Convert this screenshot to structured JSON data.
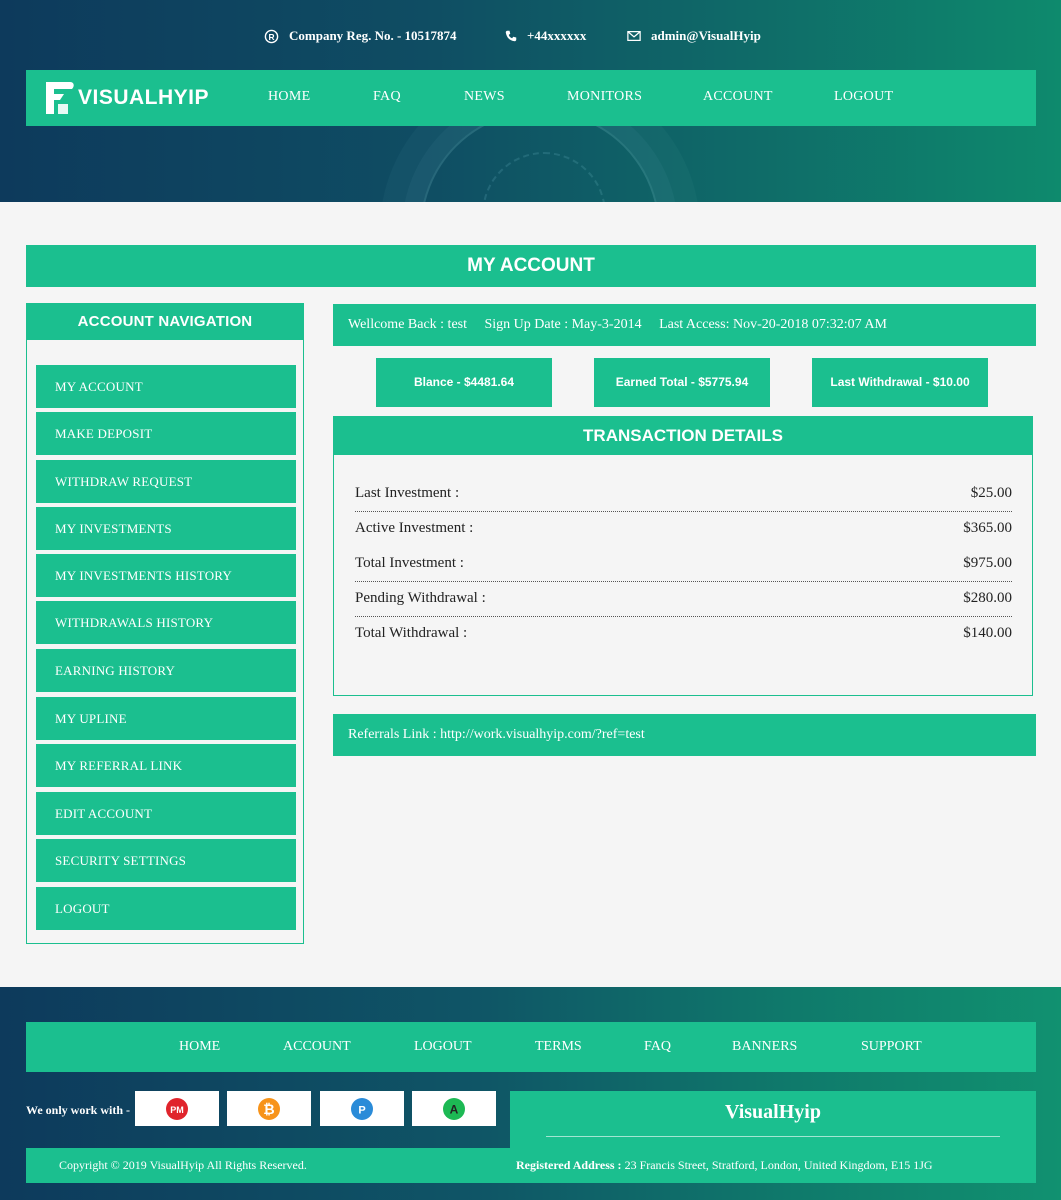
{
  "topbar": {
    "company_reg": "Company Reg. No. - 10517874",
    "phone": "+44xxxxxx",
    "email": "admin@VisualHyip"
  },
  "logo": {
    "text": "VISUALHYIP"
  },
  "nav": [
    "HOME",
    "FAQ",
    "NEWS",
    "MONITORS",
    "ACCOUNT",
    "LOGOUT"
  ],
  "page_title": "MY ACCOUNT",
  "sidebar": {
    "title": "ACCOUNT NAVIGATION",
    "items": [
      "MY ACCOUNT",
      "MAKE DEPOSIT",
      "WITHDRAW REQUEST",
      "MY INVESTMENTS",
      "MY INVESTMENTS HISTORY",
      "WITHDRAWALS HISTORY",
      "EARNING HISTORY",
      "MY UPLINE",
      "MY REFERRAL LINK",
      "EDIT ACCOUNT",
      "SECURITY SETTINGS",
      "LOGOUT"
    ]
  },
  "welcome": {
    "user": "Wellcome Back : test",
    "signup": "Sign Up Date : May-3-2014",
    "last_access": "Last Access: Nov-20-2018 07:32:07 AM"
  },
  "stats": [
    "Blance - $4481.64",
    "Earned Total - $5775.94",
    "Last Withdrawal - $10.00"
  ],
  "transactions": {
    "title": "TRANSACTION DETAILS",
    "rows": [
      {
        "label": "Last Investment :",
        "value": "$25.00"
      },
      {
        "label": "Active Investment :",
        "value": "$365.00"
      },
      {
        "label": "Total Investment :",
        "value": "$975.00"
      },
      {
        "label": "Pending Withdrawal :",
        "value": "$280.00"
      },
      {
        "label": "Total Withdrawal :",
        "value": "$140.00"
      }
    ]
  },
  "referral": {
    "text": "Referrals Link : http://work.visualhyip.com/?ref=test"
  },
  "footer": {
    "nav": [
      "HOME",
      "ACCOUNT",
      "LOGOUT",
      "TERMS",
      "FAQ",
      "BANNERS",
      "SUPPORT"
    ],
    "work_label": "We only work with -",
    "payments": [
      {
        "name": "perfect-money-icon",
        "text": "PM",
        "color": "#e0242c"
      },
      {
        "name": "bitcoin-icon",
        "text": "₿",
        "color": "#f7931a"
      },
      {
        "name": "payeer-icon",
        "text": "P",
        "color": "#2a8bd8"
      },
      {
        "name": "advcash-icon",
        "text": "A",
        "color": "#1db954"
      }
    ],
    "brand": "VisualHyip",
    "copyright": "Copyright © 2019 VisualHyip All Rights Reserved.",
    "address_label": "Registered Address :",
    "address": "23 Francis Street, Stratford, London, United Kingdom, E15 1JG"
  },
  "colors": {
    "accent": "#1bbf8f",
    "header_dark": "#0d3a5c",
    "background": "#f5f5f5"
  }
}
